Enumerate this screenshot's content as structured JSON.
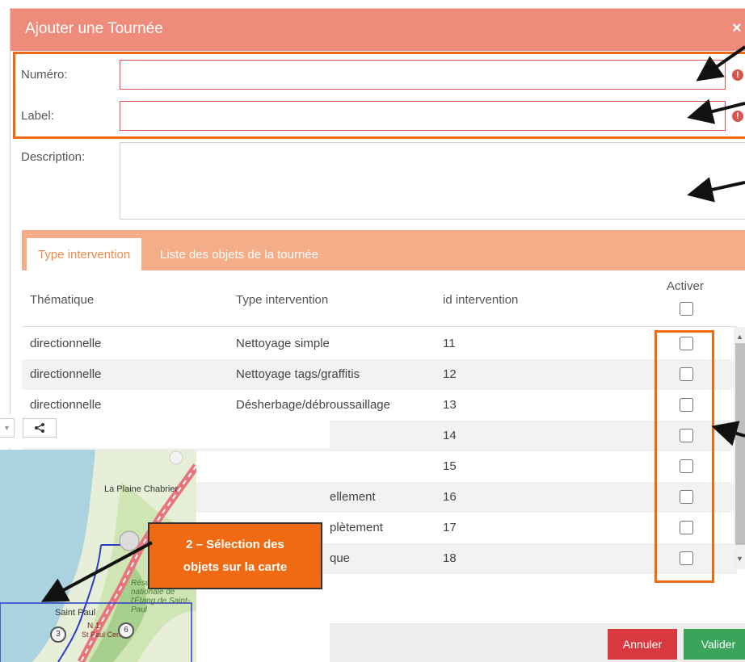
{
  "modal": {
    "title": "Ajouter une Tournée",
    "close_glyph": "×"
  },
  "form": {
    "numero_label": "Numéro:",
    "numero_value": "",
    "label_label": "Label:",
    "label_value": "",
    "description_label": "Description:",
    "description_value": "",
    "error_glyph": "!"
  },
  "tabs": [
    {
      "label": "Type intervention",
      "active": true
    },
    {
      "label": "Liste des objets de la tournée",
      "active": false
    }
  ],
  "table": {
    "headers": {
      "thematique": "Thématique",
      "type": "Type intervention",
      "id": "id intervention",
      "activer": "Activer"
    },
    "rows": [
      {
        "thematique": "directionnelle",
        "type": "Nettoyage simple",
        "id": "11",
        "checked": false
      },
      {
        "thematique": "directionnelle",
        "type": "Nettoyage tags/graffitis",
        "id": "12",
        "checked": false
      },
      {
        "thematique": "directionnelle",
        "type": "Désherbage/débroussaillage",
        "id": "13",
        "checked": false
      },
      {
        "thematique": "",
        "type": "",
        "id": "14",
        "checked": false
      },
      {
        "thematique": "",
        "type": "",
        "id": "15",
        "checked": false
      },
      {
        "thematique": "",
        "type": "ellement",
        "id": "16",
        "checked": false
      },
      {
        "thematique": "",
        "type": "plètement",
        "id": "17",
        "checked": false
      },
      {
        "thematique": "",
        "type": "que",
        "id": "18",
        "checked": false
      }
    ]
  },
  "footer": {
    "cancel_label": "Annuler",
    "submit_label": "Valider"
  },
  "map": {
    "share_icon": "share-icon",
    "places": {
      "plaine": "La Plaine Chabrier",
      "saint_paul": "Saint Paul",
      "reserve": "Réserve naturelle nationale de l'Étang de Saint-Paul",
      "n1": "N 1",
      "sp_centre": "St Paul Centre"
    },
    "markers": [
      "3",
      "6"
    ]
  },
  "callout": {
    "line1": "2 – Sélection des",
    "line2": "objets sur la carte"
  },
  "colors": {
    "header": "#ee8b7a",
    "highlight": "#f06a13",
    "tabs": "#f5ad88",
    "cancel": "#d9393e",
    "submit": "#3aa55a",
    "error": "#d9534f"
  }
}
